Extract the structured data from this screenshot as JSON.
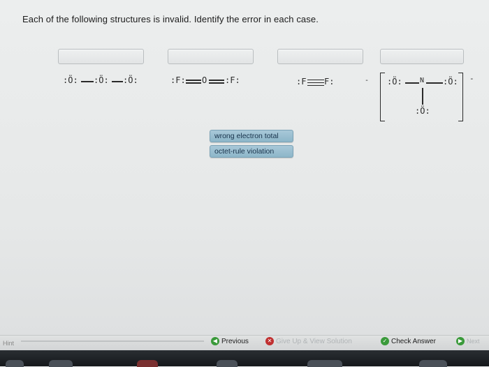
{
  "instructions": "Each of the following structures is invalid. Identify the error in each case.",
  "molecules": [
    {
      "atoms": [
        ":Ö:",
        ":Ö:",
        ":Ö:"
      ]
    },
    {
      "atoms": [
        ":F:",
        "O",
        ":F:"
      ]
    },
    {
      "atoms": [
        ":F",
        "F:"
      ]
    },
    {
      "charge": "-",
      "left_mark": "-",
      "atoms": [
        ":Ö:",
        "N",
        ":Ö:",
        ":Ö:"
      ]
    }
  ],
  "answer_options": [
    "wrong electron total",
    "octet-rule violation"
  ],
  "footer": {
    "hint": "Hint",
    "previous": "Previous",
    "give_up": "Give Up & View Solution",
    "check_answer": "Check Answer",
    "next": "Next"
  }
}
